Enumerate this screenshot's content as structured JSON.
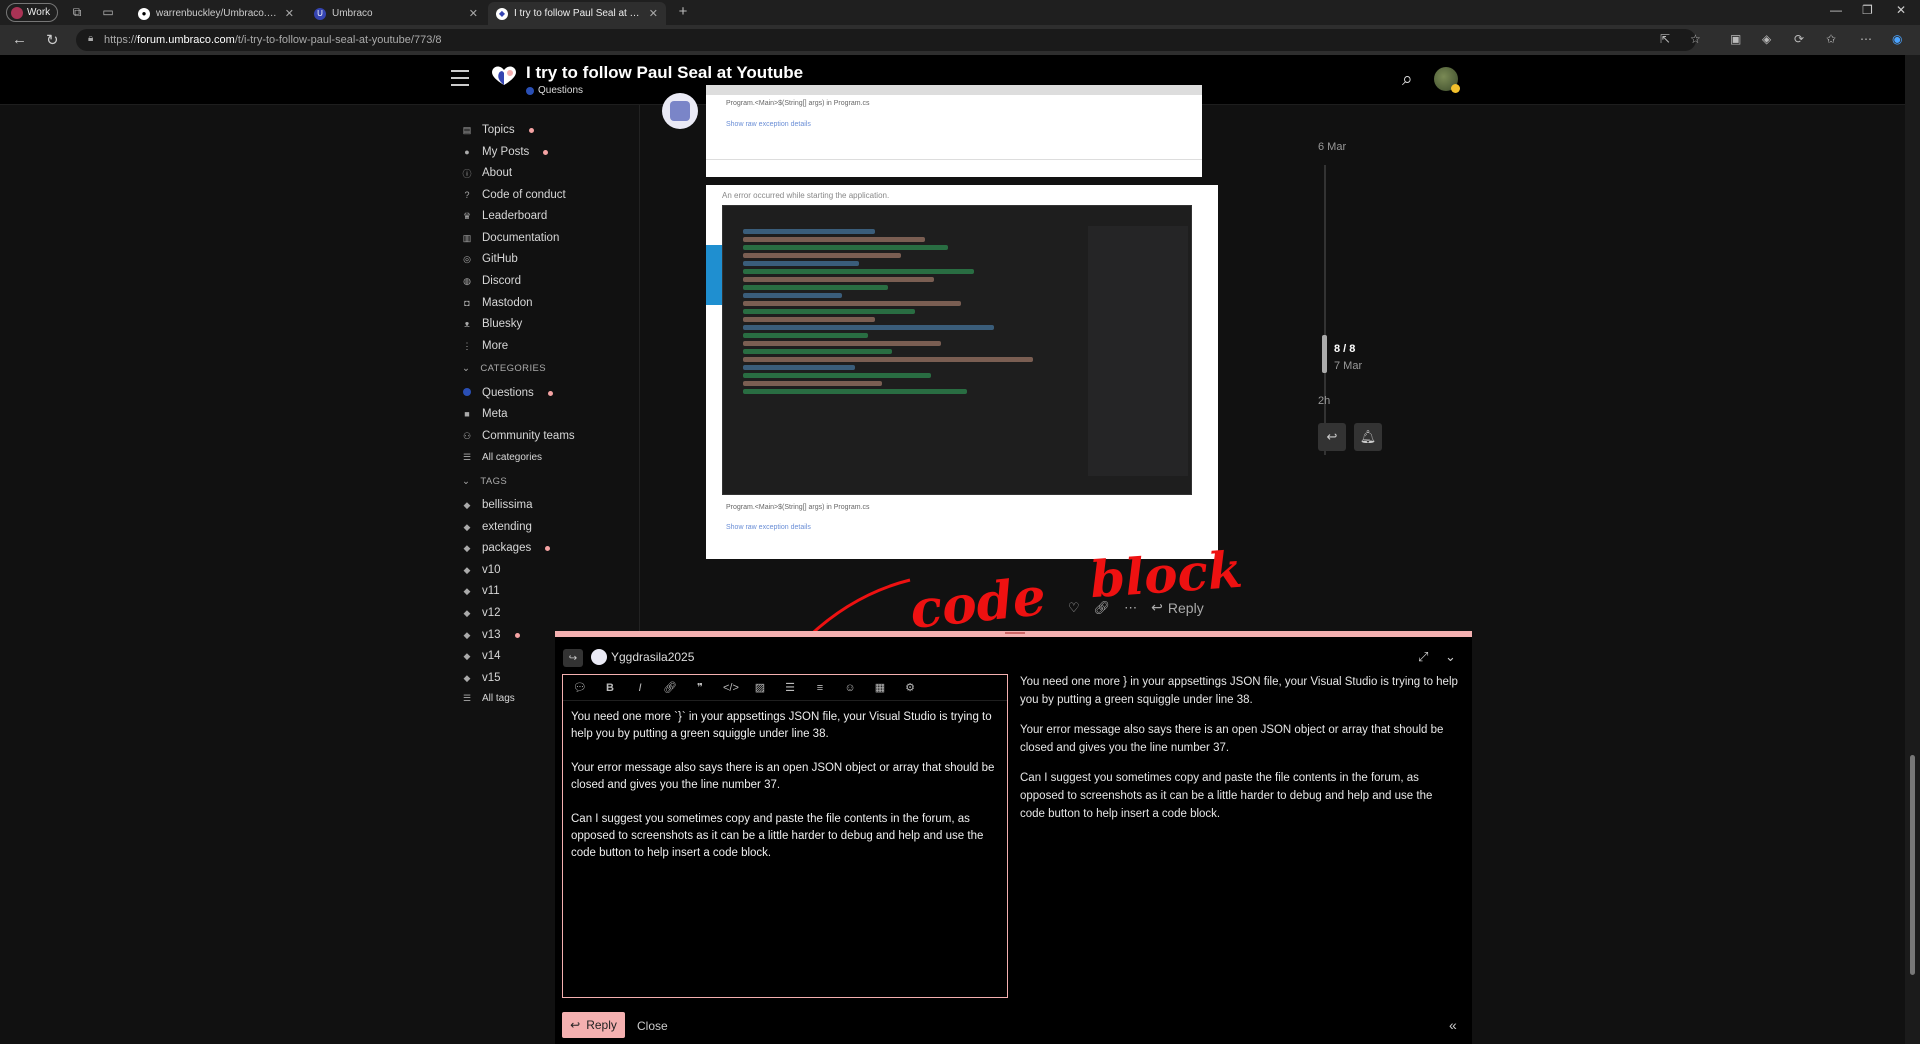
{
  "browser": {
    "profile": "Work",
    "tabs": [
      {
        "title": "warrenbuckley/Umbraco.Commu",
        "icon": "github-icon",
        "active": false
      },
      {
        "title": "Umbraco",
        "icon": "umbraco-icon",
        "active": false
      },
      {
        "title": "I try to follow Paul Seal at Youtub",
        "icon": "discourse-icon",
        "active": true
      }
    ],
    "url_prefix": "https://",
    "url_host": "forum.umbraco.com",
    "url_path": "/t/i-try-to-follow-paul-seal-at-youtube/773/8"
  },
  "topic": {
    "title": "I try to follow Paul Seal at Youtube",
    "category": "Questions"
  },
  "sidebar": {
    "items": [
      {
        "label": "Topics",
        "icon": "layers-icon",
        "unread": true
      },
      {
        "label": "My Posts",
        "icon": "user-icon",
        "unread": true
      },
      {
        "label": "About",
        "icon": "info-icon",
        "unread": false
      },
      {
        "label": "Code of conduct",
        "icon": "question-icon",
        "unread": false
      },
      {
        "label": "Leaderboard",
        "icon": "award-icon",
        "unread": false
      },
      {
        "label": "Documentation",
        "icon": "book-icon",
        "unread": false
      },
      {
        "label": "GitHub",
        "icon": "github-icon",
        "unread": false
      },
      {
        "label": "Discord",
        "icon": "discord-icon",
        "unread": false
      },
      {
        "label": "Mastodon",
        "icon": "mastodon-icon",
        "unread": false
      },
      {
        "label": "Bluesky",
        "icon": "bluesky-icon",
        "unread": false
      },
      {
        "label": "More",
        "icon": "more-icon",
        "unread": false
      }
    ],
    "categories_heading": "CATEGORIES",
    "categories": [
      {
        "label": "Questions",
        "unread": true
      },
      {
        "label": "Meta",
        "unread": false
      },
      {
        "label": "Community teams",
        "unread": false
      }
    ],
    "all_categories": "All categories",
    "tags_heading": "TAGS",
    "tags": [
      {
        "label": "bellissima",
        "unread": false
      },
      {
        "label": "extending",
        "unread": false
      },
      {
        "label": "packages",
        "unread": true
      },
      {
        "label": "v10",
        "unread": false
      },
      {
        "label": "v11",
        "unread": false
      },
      {
        "label": "v12",
        "unread": false
      },
      {
        "label": "v13",
        "unread": true
      },
      {
        "label": "v14",
        "unread": false
      },
      {
        "label": "v15",
        "unread": false
      }
    ],
    "all_tags": "All tags"
  },
  "post": {
    "error_heading": "An error occurred while starting the application.",
    "error_line1": "Program.<Main>$(String[] args) in Program.cs",
    "error_line2": "Show raw exception details",
    "annotation_code": "code",
    "annotation_block": "block",
    "actions": {
      "reply": "Reply"
    }
  },
  "timeline": {
    "start_date": "6 Mar",
    "position": "8 / 8",
    "position_date": "7 Mar",
    "end_date": "2h"
  },
  "composer": {
    "username": "Yggdrasila2025",
    "editor_paragraphs": [
      "You need one more `}` in your appsettings JSON file, your Visual Studio is trying to help you by putting a green squiggle under line 38.",
      "Your error message also says there is an open JSON object or array that should be closed and gives you the line number 37.",
      "Can I suggest you sometimes copy and paste the file contents in the forum, as opposed to screenshots as it can be a little harder to debug and help and use the code button to help insert a code block."
    ],
    "preview_paragraphs": [
      "You need one more  }  in your appsettings JSON file, your Visual Studio is trying to help you by putting a green squiggle under line 38.",
      "Your error message also says there is an open JSON object or array that should be closed and gives you the line number 37.",
      "Can I suggest you sometimes copy and paste the file contents in the forum, as opposed to screenshots as it can be a little harder to debug and help and use the code button to help insert a code block."
    ],
    "reply_label": "Reply",
    "close_label": "Close"
  },
  "colors": {
    "accent": "#f4b0b0",
    "category": "#2a4fb5",
    "annotation": "#e11111"
  }
}
